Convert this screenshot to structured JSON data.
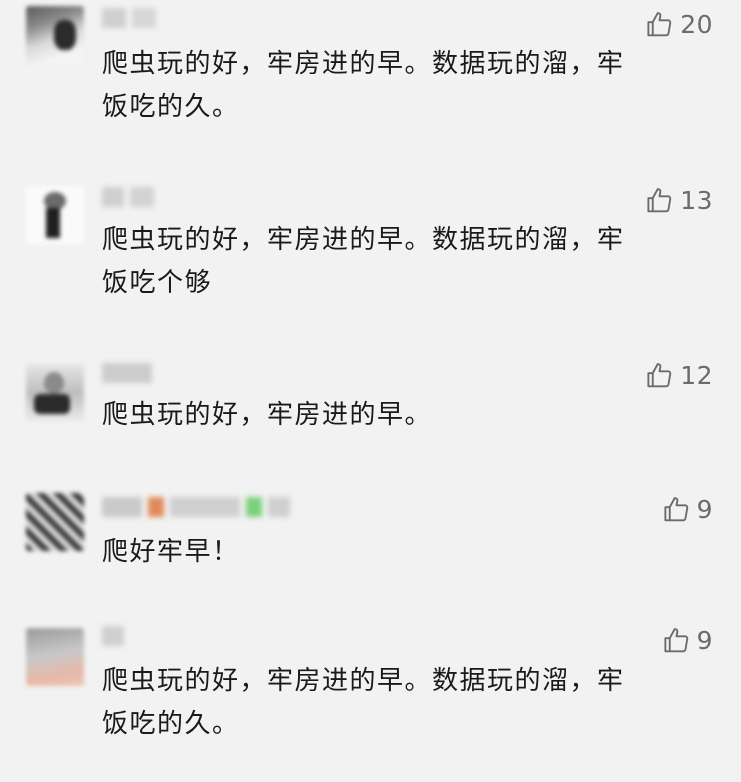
{
  "comments": [
    {
      "likes": "20",
      "text": "爬虫玩的好，牢房进的早。数据玩的溜，牢\n饭吃的久。"
    },
    {
      "likes": "13",
      "text": "爬虫玩的好，牢房进的早。数据玩的溜，牢\n饭吃个够"
    },
    {
      "likes": "12",
      "text": "爬虫玩的好，牢房进的早。"
    },
    {
      "likes": "9",
      "text": "爬好牢早！"
    },
    {
      "likes": "9",
      "text": "爬虫玩的好，牢房进的早。数据玩的溜，牢\n饭吃的久。"
    }
  ],
  "icons": {
    "like": "thumbs-up-outline-icon"
  },
  "colors": {
    "background": "#f2f2f2",
    "text": "#1a1a1a",
    "like": "#6b6b6b"
  }
}
